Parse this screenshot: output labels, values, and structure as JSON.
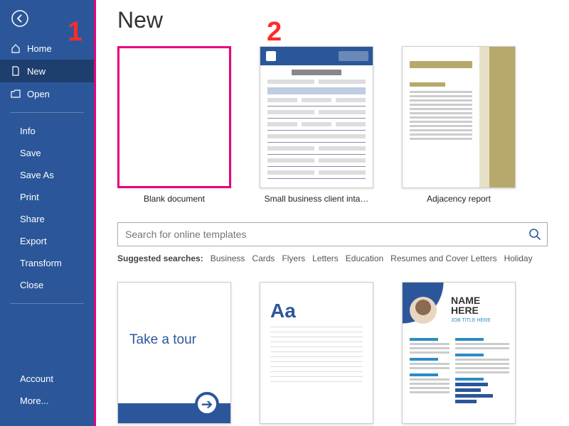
{
  "annotations": {
    "one": "1",
    "two": "2"
  },
  "sidebar": {
    "back_label": "Back",
    "items": [
      {
        "label": "Home",
        "icon": "home-icon"
      },
      {
        "label": "New",
        "icon": "document-icon"
      },
      {
        "label": "Open",
        "icon": "folder-icon"
      }
    ],
    "sub_items": [
      {
        "label": "Info"
      },
      {
        "label": "Save"
      },
      {
        "label": "Save As"
      },
      {
        "label": "Print"
      },
      {
        "label": "Share"
      },
      {
        "label": "Export"
      },
      {
        "label": "Transform"
      },
      {
        "label": "Close"
      }
    ],
    "bottom_items": [
      {
        "label": "Account"
      },
      {
        "label": "More..."
      }
    ]
  },
  "main": {
    "title": "New",
    "templates_row1": [
      {
        "label": "Blank document"
      },
      {
        "label": "Small business client inta…"
      },
      {
        "label": "Adjacency report"
      }
    ],
    "search": {
      "placeholder": "Search for online templates"
    },
    "suggested_label": "Suggested searches:",
    "suggested": [
      "Business",
      "Cards",
      "Flyers",
      "Letters",
      "Education",
      "Resumes and Cover Letters",
      "Holiday"
    ],
    "templates_row2": {
      "tour_text": "Take a tour",
      "aa_text": "Aa",
      "resume_name1": "NAME",
      "resume_name2": "HERE",
      "resume_subtitle": "JOB TITLE HERE"
    }
  }
}
